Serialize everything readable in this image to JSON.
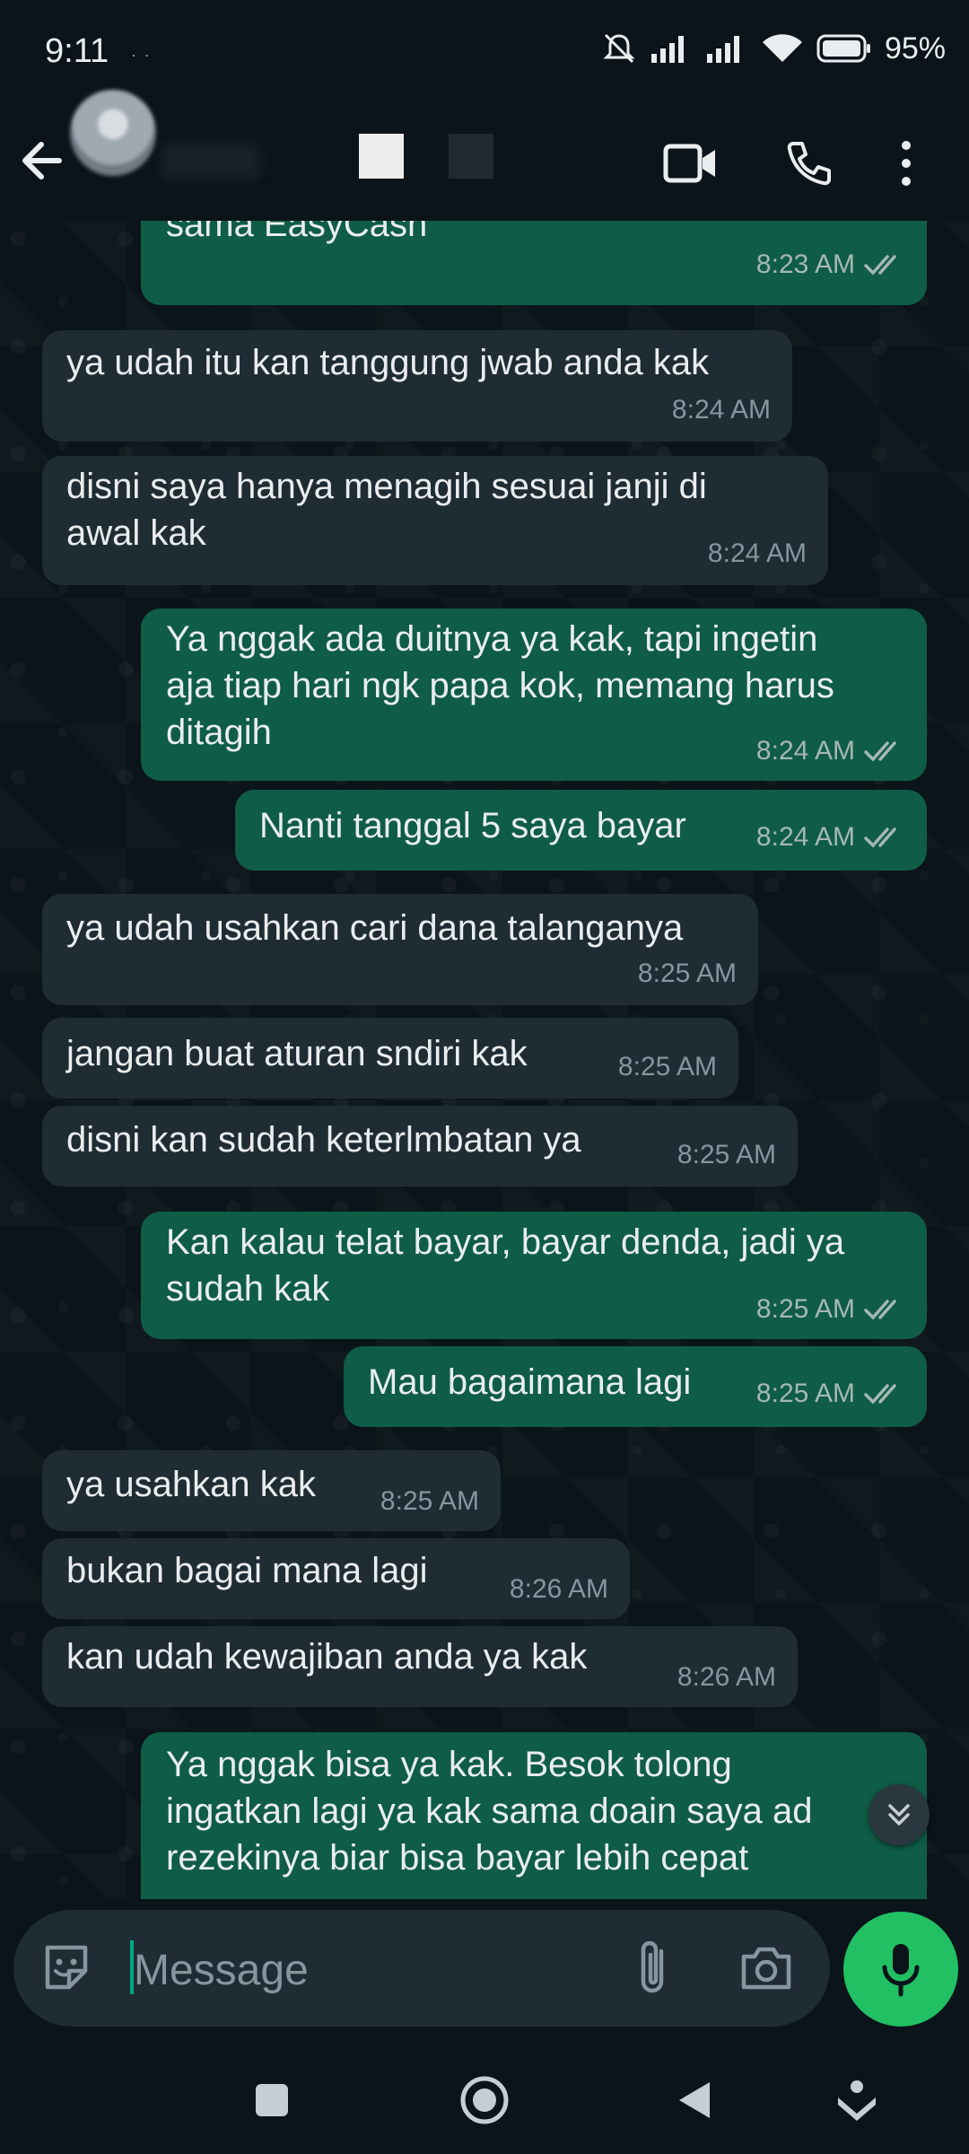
{
  "status_bar": {
    "time": "9:11",
    "extra": "ᐧ ᐧ",
    "battery": "95%"
  },
  "header": {
    "back_label": "back",
    "icons": [
      "video-call-icon",
      "phone-icon",
      "more-icon"
    ]
  },
  "messages": [
    {
      "dir": "out",
      "text": "sama EasyCash",
      "time": "8:23 AM"
    },
    {
      "dir": "in",
      "text": "ya udah itu kan tanggung jwab anda kak",
      "time": "8:24 AM"
    },
    {
      "dir": "in",
      "text": "disni saya hanya menagih sesuai janji di\nawal kak",
      "time": "8:24 AM"
    },
    {
      "dir": "out",
      "text": "Ya nggak ada duitnya ya kak, tapi ingetin\naja tiap hari ngk papa kok, memang harus\nditagih",
      "time": "8:24 AM"
    },
    {
      "dir": "out",
      "text": "Nanti tanggal 5 saya bayar",
      "time": "8:24 AM"
    },
    {
      "dir": "in",
      "text": "ya udah usahkan cari dana talanganya",
      "time": "8:25 AM"
    },
    {
      "dir": "in",
      "text": "jangan buat aturan sndiri kak",
      "time": "8:25 AM"
    },
    {
      "dir": "in",
      "text": "disni kan sudah keterlmbatan ya",
      "time": "8:25 AM"
    },
    {
      "dir": "out",
      "text": "Kan kalau telat bayar, bayar denda, jadi ya\nsudah kak",
      "time": "8:25 AM"
    },
    {
      "dir": "out",
      "text": "Mau bagaimana lagi",
      "time": "8:25 AM"
    },
    {
      "dir": "in",
      "text": "ya usahkan kak",
      "time": "8:25 AM"
    },
    {
      "dir": "in",
      "text": "bukan bagai mana lagi",
      "time": "8:26 AM"
    },
    {
      "dir": "in",
      "text": "kan udah kewajiban anda ya kak",
      "time": "8:26 AM"
    },
    {
      "dir": "out",
      "text": "Ya nggak bisa ya kak. Besok tolong\ningatkan lagi ya kak sama doain saya ad\nrezekinya biar bisa bayar lebih cepat",
      "time": ""
    }
  ],
  "composer": {
    "placeholder": "Message"
  },
  "colors": {
    "background": "#0b141a",
    "incoming": "#202c33",
    "outgoing": "#0f5c47",
    "accent": "#21c063",
    "read_ticks": "#a6b8b2"
  }
}
